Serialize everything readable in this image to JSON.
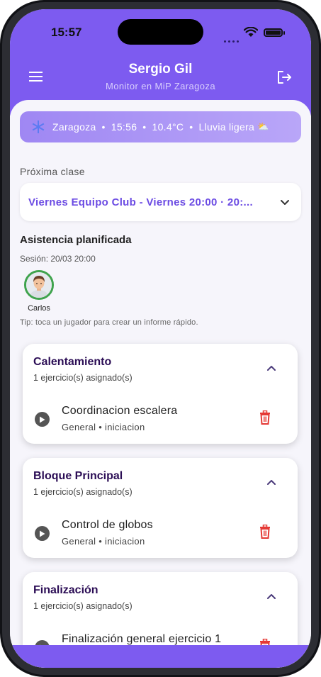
{
  "status_bar": {
    "time": "15:57"
  },
  "header": {
    "title": "Sergio Gil",
    "subtitle": "Monitor en MiP Zaragoza"
  },
  "weather": {
    "city": "Zaragoza",
    "time": "15:56",
    "temperature": "10.4°C",
    "condition": "Lluvia ligera",
    "separator": "•",
    "condition_icon": "⛅"
  },
  "next_class": {
    "label": "Próxima clase",
    "selected": "Viernes Equipo Club - Viernes 20:00 · 20:..."
  },
  "attendance": {
    "title": "Asistencia planificada",
    "session": "Sesión: 20/03 20:00",
    "players": [
      {
        "name": "Carlos"
      }
    ],
    "tip": "Tip: toca un jugador para crear un informe rápido."
  },
  "blocks": [
    {
      "title": "Calentamiento",
      "count": "1 ejercicio(s) asignado(s)",
      "exercises": [
        {
          "name": "Coordinacion escalera",
          "meta": "General • iniciacion"
        }
      ]
    },
    {
      "title": "Bloque Principal",
      "count": "1 ejercicio(s) asignado(s)",
      "exercises": [
        {
          "name": "Control de globos",
          "meta": "General • iniciacion"
        }
      ]
    },
    {
      "title": "Finalización",
      "count": "1 ejercicio(s) asignado(s)",
      "exercises": [
        {
          "name": "Finalización general ejercicio 1",
          "meta": ""
        }
      ]
    }
  ],
  "colors": {
    "primary": "#7d5bf0",
    "accent_text": "#6b4be3",
    "block_title": "#2b0d55",
    "delete": "#e53935",
    "attendance_ring": "#3fa34d"
  },
  "icons": {
    "menu": "menu-icon",
    "logout": "logout-icon",
    "weather": "snowflake-icon",
    "dropdown": "chevron-down-icon",
    "collapse": "chevron-up-icon",
    "play": "play-circle-icon",
    "delete": "trash-icon"
  }
}
